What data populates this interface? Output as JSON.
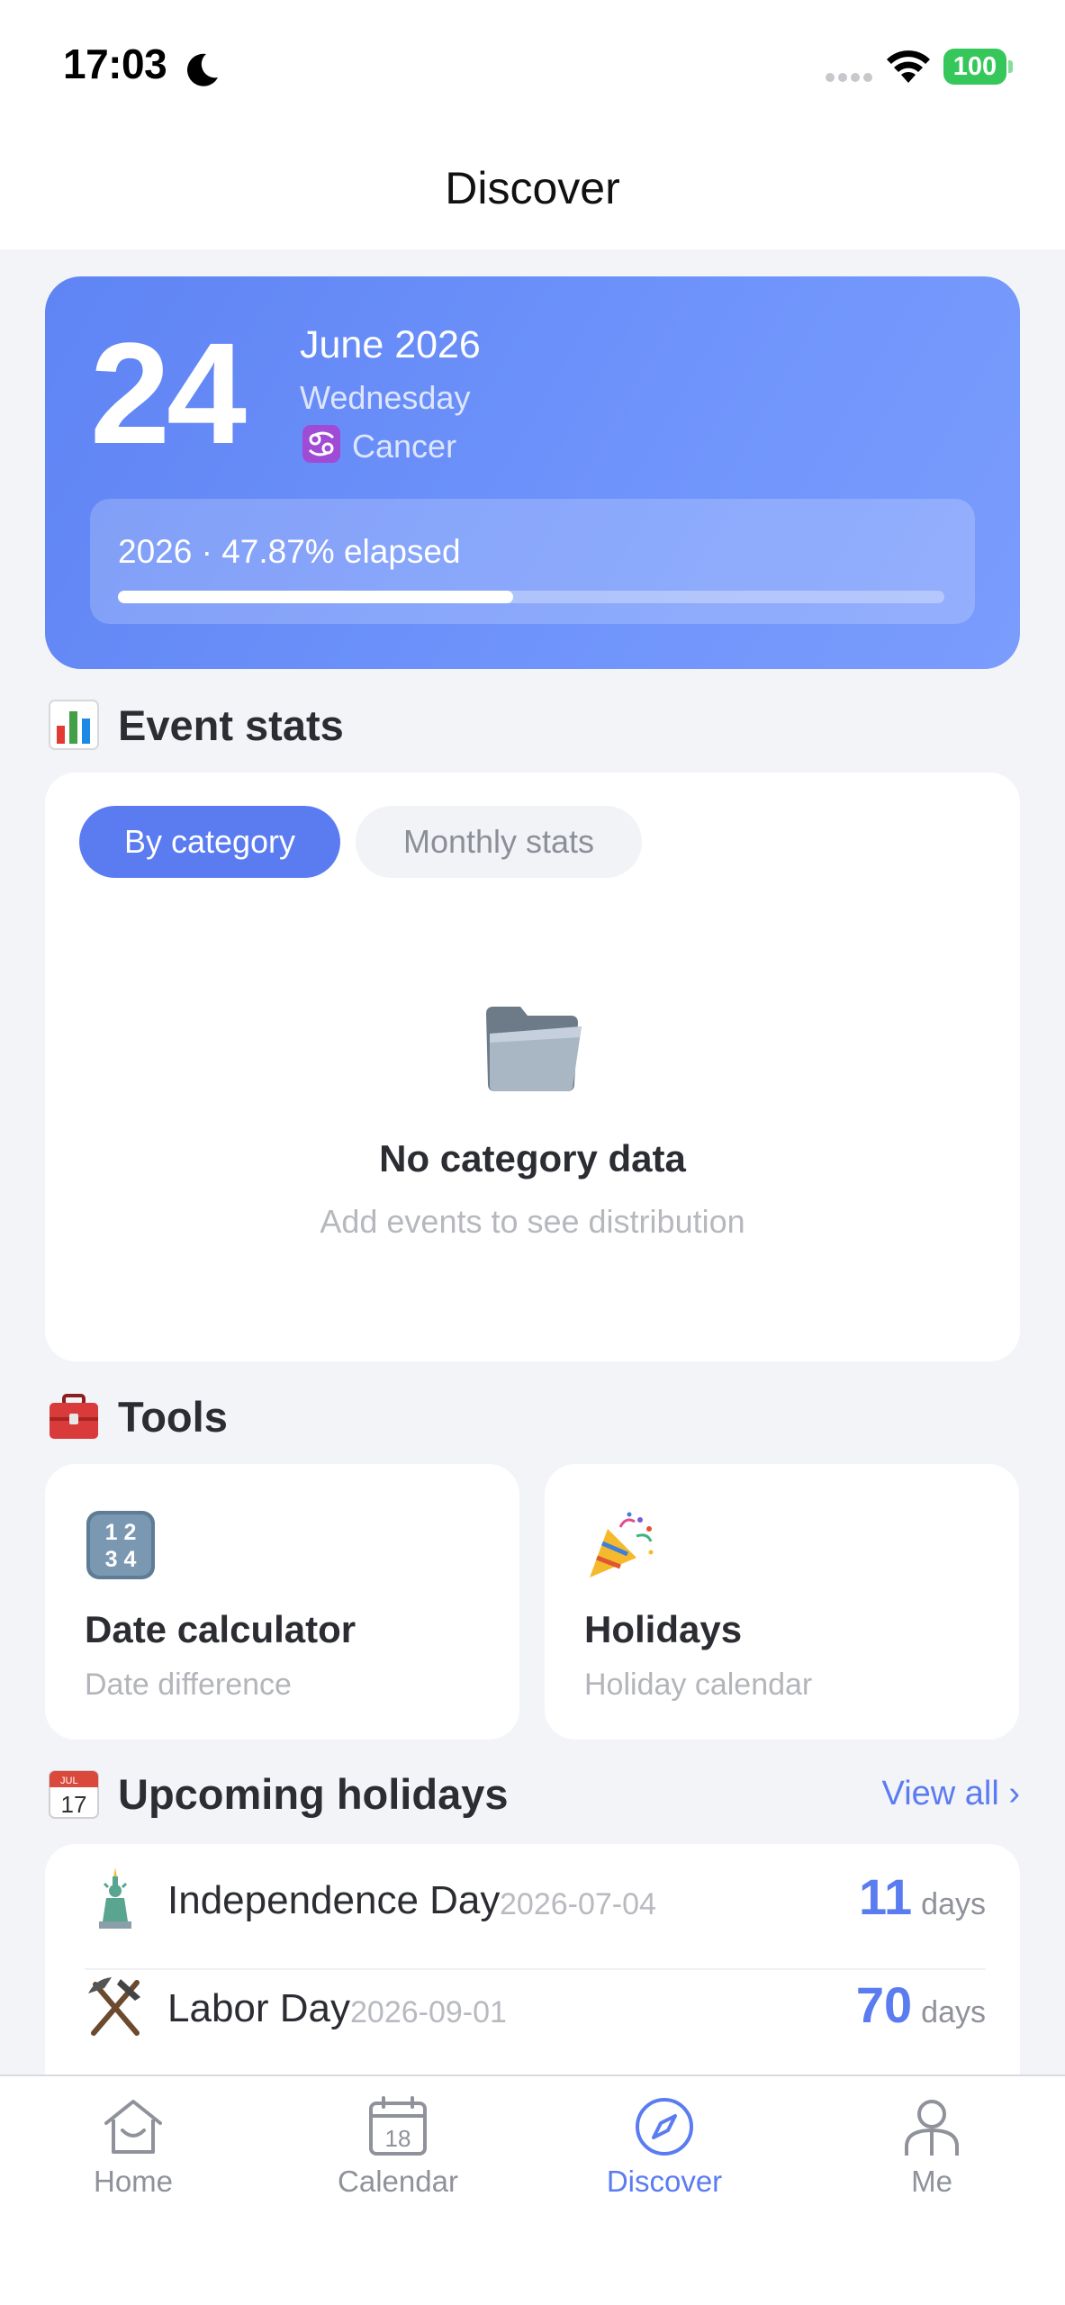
{
  "status_bar": {
    "time": "17:03",
    "battery": "100"
  },
  "header": {
    "title": "Discover"
  },
  "date_card": {
    "day": "24",
    "month_year": "June 2026",
    "weekday": "Wednesday",
    "zodiac": "Cancer",
    "progress_text": "2026 · 47.87% elapsed",
    "progress_fraction": 0.4787
  },
  "event_stats": {
    "title": "Event stats",
    "icon": "bar-chart-icon",
    "tabs": [
      {
        "label": "By category",
        "active": true
      },
      {
        "label": "Monthly stats",
        "active": false
      }
    ],
    "empty_title": "No category data",
    "empty_subtitle": "Add events to see distribution",
    "empty_icon": "folder-icon"
  },
  "tools": {
    "title": "Tools",
    "icon": "toolbox-icon",
    "items": [
      {
        "title": "Date calculator",
        "subtitle": "Date difference",
        "icon": "numbers-icon"
      },
      {
        "title": "Holidays",
        "subtitle": "Holiday calendar",
        "icon": "party-popper-icon"
      }
    ]
  },
  "upcoming_holidays": {
    "title": "Upcoming holidays",
    "icon": "calendar-icon",
    "calendar_icon_month": "JUL",
    "calendar_icon_day": "17",
    "view_all": "View all ›",
    "items": [
      {
        "name": "Independence Day",
        "date": "2026-07-04",
        "days": "11",
        "unit": "days",
        "icon": "statue-of-liberty-icon"
      },
      {
        "name": "Labor Day",
        "date": "2026-09-01",
        "days": "70",
        "unit": "days",
        "icon": "hammer-pick-icon"
      }
    ]
  },
  "tab_bar": {
    "items": [
      {
        "label": "Home",
        "icon": "home-icon",
        "active": false
      },
      {
        "label": "Calendar",
        "icon": "calendar-icon",
        "calendar_day": "18",
        "active": false
      },
      {
        "label": "Discover",
        "icon": "compass-icon",
        "active": true
      },
      {
        "label": "Me",
        "icon": "person-icon",
        "active": false
      }
    ]
  },
  "colors": {
    "accent": "#5b7cf1",
    "card_gradient_start": "#5f84f4",
    "card_gradient_end": "#7a9cfd",
    "battery": "#35c759"
  }
}
